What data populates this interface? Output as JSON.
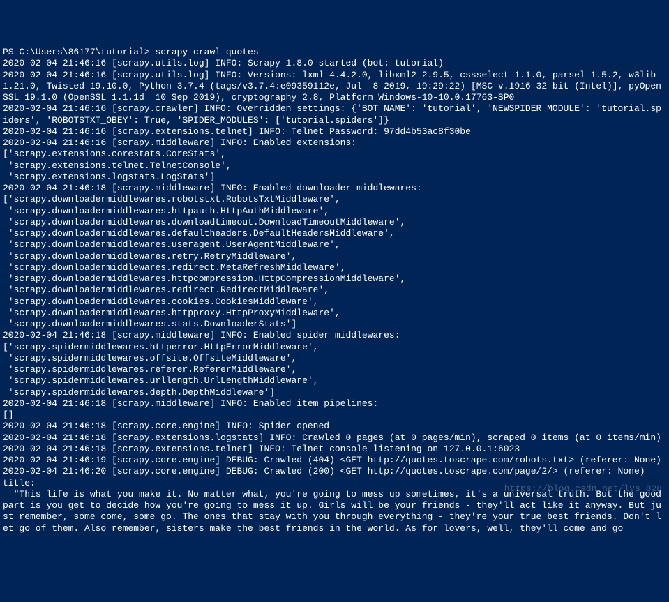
{
  "terminal": {
    "lines": [
      "PS C:\\Users\\86177\\tutorial> scrapy crawl quotes",
      "2020-02-04 21:46:16 [scrapy.utils.log] INFO: Scrapy 1.8.0 started (bot: tutorial)",
      "2020-02-04 21:46:16 [scrapy.utils.log] INFO: Versions: lxml 4.4.2.0, libxml2 2.9.5, cssselect 1.1.0, parsel 1.5.2, w3lib 1.21.0, Twisted 19.10.0, Python 3.7.4 (tags/v3.7.4:e09359112e, Jul  8 2019, 19:29:22) [MSC v.1916 32 bit (Intel)], pyOpenSSL 19.1.0 (OpenSSL 1.1.1d  10 Sep 2019), cryptography 2.8, Platform Windows-10-10.0.17763-SP0",
      "2020-02-04 21:46:16 [scrapy.crawler] INFO: Overridden settings: {'BOT_NAME': 'tutorial', 'NEWSPIDER_MODULE': 'tutorial.spiders', 'ROBOTSTXT_OBEY': True, 'SPIDER_MODULES': ['tutorial.spiders']}",
      "2020-02-04 21:46:16 [scrapy.extensions.telnet] INFO: Telnet Password: 97dd4b53ac8f30be",
      "2020-02-04 21:46:16 [scrapy.middleware] INFO: Enabled extensions:",
      "['scrapy.extensions.corestats.CoreStats',",
      " 'scrapy.extensions.telnet.TelnetConsole',",
      " 'scrapy.extensions.logstats.LogStats']",
      "2020-02-04 21:46:18 [scrapy.middleware] INFO: Enabled downloader middlewares:",
      "['scrapy.downloadermiddlewares.robotstxt.RobotsTxtMiddleware',",
      " 'scrapy.downloadermiddlewares.httpauth.HttpAuthMiddleware',",
      " 'scrapy.downloadermiddlewares.downloadtimeout.DownloadTimeoutMiddleware',",
      " 'scrapy.downloadermiddlewares.defaultheaders.DefaultHeadersMiddleware',",
      " 'scrapy.downloadermiddlewares.useragent.UserAgentMiddleware',",
      " 'scrapy.downloadermiddlewares.retry.RetryMiddleware',",
      " 'scrapy.downloadermiddlewares.redirect.MetaRefreshMiddleware',",
      " 'scrapy.downloadermiddlewares.httpcompression.HttpCompressionMiddleware',",
      " 'scrapy.downloadermiddlewares.redirect.RedirectMiddleware',",
      " 'scrapy.downloadermiddlewares.cookies.CookiesMiddleware',",
      " 'scrapy.downloadermiddlewares.httpproxy.HttpProxyMiddleware',",
      " 'scrapy.downloadermiddlewares.stats.DownloaderStats']",
      "2020-02-04 21:46:18 [scrapy.middleware] INFO: Enabled spider middlewares:",
      "['scrapy.spidermiddlewares.httperror.HttpErrorMiddleware',",
      " 'scrapy.spidermiddlewares.offsite.OffsiteMiddleware',",
      " 'scrapy.spidermiddlewares.referer.RefererMiddleware',",
      " 'scrapy.spidermiddlewares.urllength.UrlLengthMiddleware',",
      " 'scrapy.spidermiddlewares.depth.DepthMiddleware']",
      "2020-02-04 21:46:18 [scrapy.middleware] INFO: Enabled item pipelines:",
      "[]",
      "2020-02-04 21:46:18 [scrapy.core.engine] INFO: Spider opened",
      "2020-02-04 21:46:18 [scrapy.extensions.logstats] INFO: Crawled 0 pages (at 0 pages/min), scraped 0 items (at 0 items/min)",
      "2020-02-04 21:46:18 [scrapy.extensions.telnet] INFO: Telnet console listening on 127.0.0.1:6023",
      "2020-02-04 21:46:19 [scrapy.core.engine] DEBUG: Crawled (404) <GET http://quotes.toscrape.com/robots.txt> (referer: None)",
      "2020-02-04 21:46:20 [scrapy.core.engine] DEBUG: Crawled (200) <GET http://quotes.toscrape.com/page/2/> (referer: None)",
      "title:",
      "  \"This life is what you make it. No matter what, you're going to mess up sometimes, it's a universal truth. But the good part is you get to decide how you're going to mess it up. Girls will be your friends - they'll act like it anyway. But just remember, some come, some go. The ones that stay with you through everything - they're your true best friends. Don't let go of them. Also remember, sisters make the best friends in the world. As for lovers, well, they'll come and go"
    ]
  },
  "watermark": "https://blog.csdn.net/lys_828"
}
